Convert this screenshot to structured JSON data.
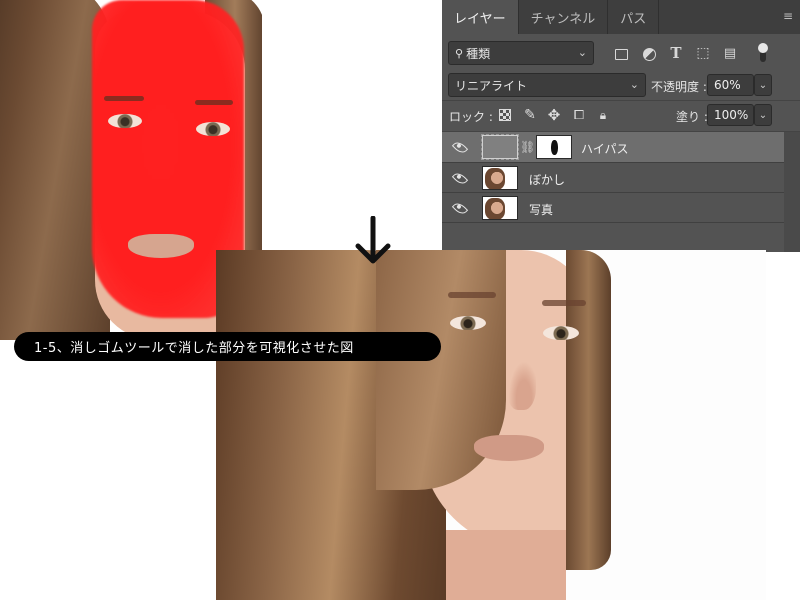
{
  "caption": "1-5、消しゴムツールで消した部分を可視化させた図",
  "layers_panel": {
    "tabs": [
      {
        "label": "レイヤー"
      },
      {
        "label": "チャンネル"
      },
      {
        "label": "パス"
      }
    ],
    "active_tab": "レイヤー",
    "filter": {
      "label": "種類"
    },
    "blend_mode": "リニアライト",
    "opacity_label": "不透明度 :",
    "opacity_value": "60%",
    "lock_label": "ロック :",
    "fill_label": "塗り :",
    "fill_value": "100%",
    "layers": [
      {
        "name": "ハイパス",
        "selected": true
      },
      {
        "name": "ぼかし",
        "selected": false
      },
      {
        "name": "写真",
        "selected": false
      }
    ],
    "colors": {
      "panel_bg": "#535353",
      "tab_bar": "#3e3e3e",
      "selected_row": "#6e6e6e"
    }
  },
  "mask_overlay_color": "#ff1f1f"
}
